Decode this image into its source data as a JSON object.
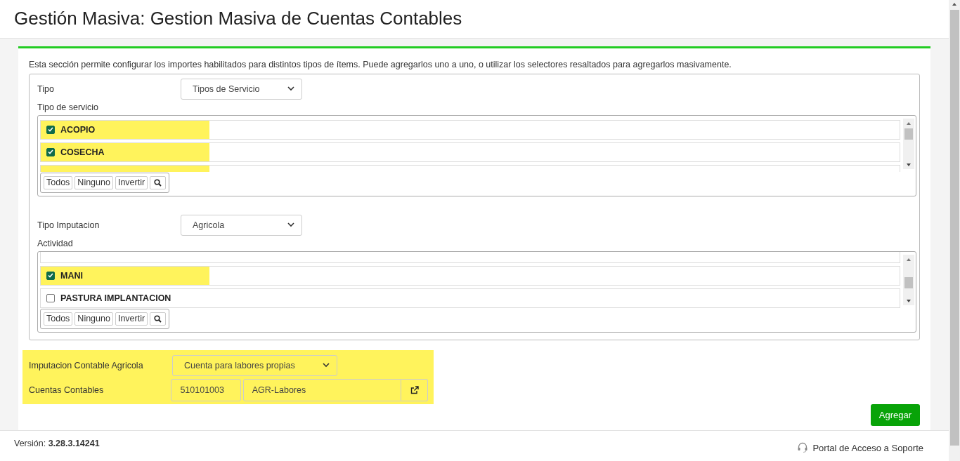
{
  "page_title": "Gestión Masiva: Gestion Masiva de Cuentas Contables",
  "description": "Esta sección permite configurar los importes habilitados para distintos tipos de ítems. Puede agregarlos uno a uno, o utilizar los selectores resaltados para agregarlos masivamente.",
  "tipo": {
    "label": "Tipo",
    "value": "Tipos de Servicio"
  },
  "servicios": {
    "label": "Tipo de servicio",
    "items": [
      {
        "label": "ACOPIO",
        "checked": true
      },
      {
        "label": "COSECHA",
        "checked": true
      },
      {
        "kind": "partial",
        "checked": true
      }
    ],
    "buttons": [
      "Todos",
      "Ninguno",
      "Invertir"
    ]
  },
  "tipo_imputacion": {
    "label": "Tipo Imputacion",
    "value": "Agricola"
  },
  "actividad": {
    "label": "Actividad",
    "items": [
      {
        "kind": "partial",
        "checked": false
      },
      {
        "label": "MANI",
        "checked": true
      },
      {
        "label": "PASTURA IMPLANTACION",
        "checked": false
      }
    ],
    "buttons": [
      "Todos",
      "Ninguno",
      "Invertir"
    ]
  },
  "imputacion_contable": {
    "label": "Imputacion Contable Agricola",
    "value": "Cuenta para labores propias"
  },
  "cuentas": {
    "label": "Cuentas Contables",
    "code": "510101003",
    "name": "AGR-Labores"
  },
  "add_button": "Agregar",
  "footer": {
    "version_label": "Versión:",
    "version": "3.28.3.14241",
    "support": "Portal de Acceso a Soporte"
  }
}
